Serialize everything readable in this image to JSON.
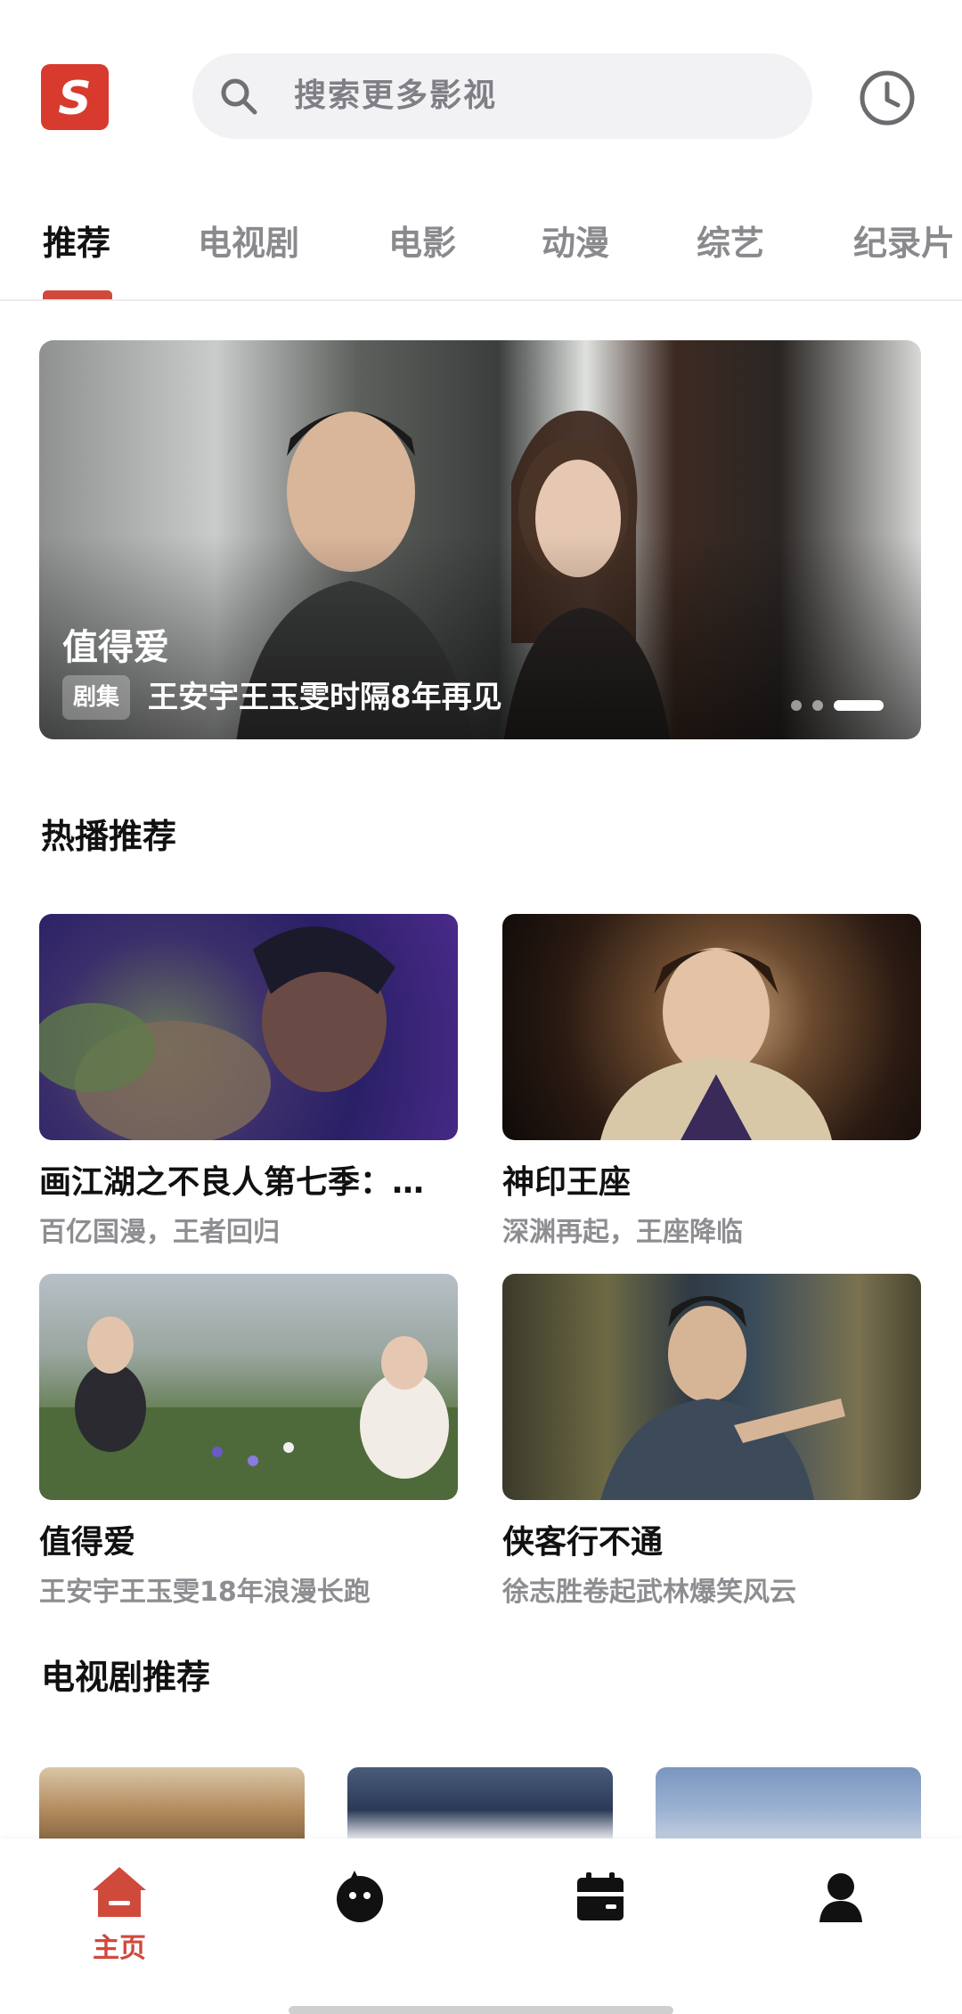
{
  "header": {
    "logo_letter": "S",
    "search_placeholder": "搜索更多影视"
  },
  "tabs": [
    {
      "label": "推荐",
      "active": true
    },
    {
      "label": "电视剧",
      "active": false
    },
    {
      "label": "电影",
      "active": false
    },
    {
      "label": "动漫",
      "active": false
    },
    {
      "label": "综艺",
      "active": false
    },
    {
      "label": "纪录片",
      "active": false
    }
  ],
  "banner": {
    "title": "值得爱",
    "tag": "剧集",
    "subtitle": "王安宇王玉雯时隔8年再见"
  },
  "sections": {
    "hot_title": "热播推荐",
    "tv_title": "电视剧推荐"
  },
  "hot_cards": [
    {
      "title": "画江湖之不良人第七季：…",
      "subtitle": "百亿国漫，王者回归"
    },
    {
      "title": "神印王座",
      "subtitle": "深渊再起，王座降临"
    },
    {
      "title": "值得爱",
      "subtitle": "王安宇王玉雯18年浪漫长跑"
    },
    {
      "title": "侠客行不通",
      "subtitle": "徐志胜卷起武林爆笑风云"
    }
  ],
  "bottom_nav": [
    {
      "label": "主页",
      "icon": "home-icon",
      "active": true
    },
    {
      "label": "",
      "icon": "mascot-icon",
      "active": false
    },
    {
      "label": "",
      "icon": "calendar-icon",
      "active": false
    },
    {
      "label": "",
      "icon": "user-icon",
      "active": false
    }
  ],
  "colors": {
    "accent": "#d04a3c",
    "logo_bg": "#d83a2e"
  }
}
